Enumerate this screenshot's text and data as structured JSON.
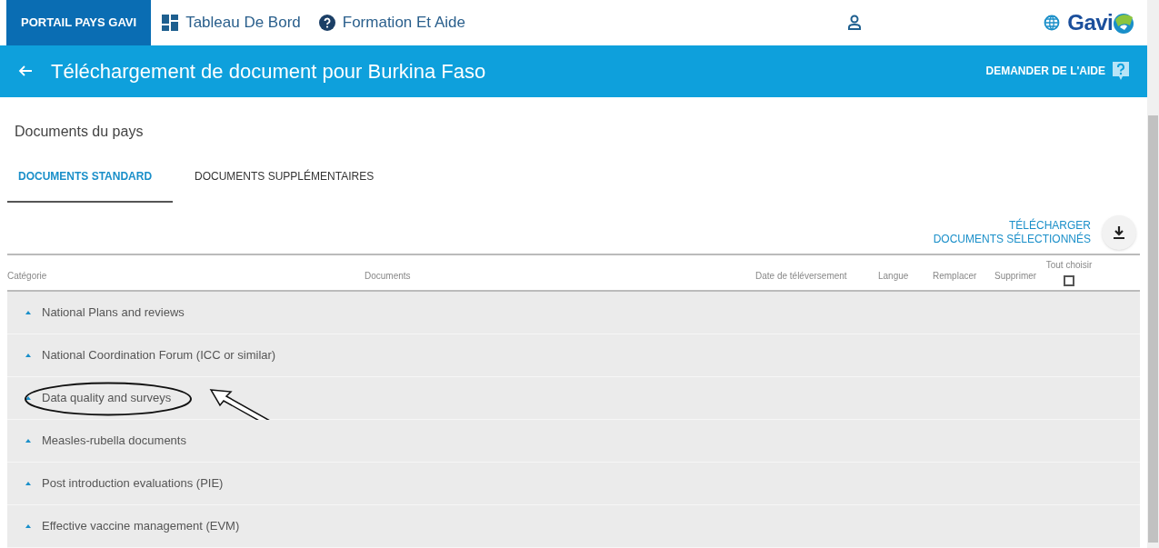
{
  "top_nav": {
    "brand": "PORTAIL PAYS GAVI",
    "logo": "Gavi",
    "links": [
      {
        "kind": "dashboard",
        "label": "Tableau De Bord"
      },
      {
        "kind": "help",
        "label": "Formation Et Aide"
      }
    ]
  },
  "header": {
    "title": "Téléchargement de document pour Burkina Faso",
    "help_button": "DEMANDER DE L'AIDE"
  },
  "section_title": "Documents du pays",
  "tabs": [
    {
      "label": "DOCUMENTS STANDARD",
      "selected": true
    },
    {
      "label": "DOCUMENTS SUPPLÉMENTAIRES",
      "selected": false
    }
  ],
  "download_button": {
    "line_1": "TÉLÉCHARGER",
    "line_2": "DOCUMENTS SÉLECTIONNÉS"
  },
  "table": {
    "columns": [
      "Catégorie",
      "Documents",
      "Date de téléversement",
      "Langue",
      "Remplacer",
      "Supprimer"
    ],
    "select_all": {
      "label": "Tout choisir",
      "checked": false
    },
    "rows": [
      {
        "label": "National Plans and reviews",
        "highlighted": false
      },
      {
        "label": "National Coordination Forum (ICC or similar)",
        "highlighted": false
      },
      {
        "label": "Data quality and surveys",
        "highlighted": true
      },
      {
        "label": "Measles-rubella documents",
        "highlighted": false
      },
      {
        "label": "Post introduction evaluations (PIE)",
        "highlighted": false
      },
      {
        "label": "Effective vaccine management (EVM)",
        "highlighted": false
      }
    ]
  }
}
